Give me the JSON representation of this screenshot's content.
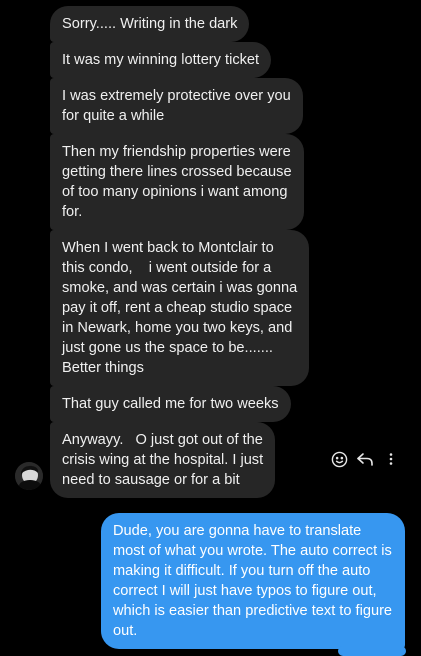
{
  "incoming_messages": [
    {
      "text": "Sorry..... Writing in the dark"
    },
    {
      "text": "It was my winning lottery ticket"
    },
    {
      "text": "I was extremely protective over you\nfor quite a while"
    },
    {
      "text": "Then my friendship properties were\ngetting there lines crossed because\nof too many opinions i want among\nfor."
    },
    {
      "text": "When I went back to Montclair to\nthis condo,    i went outside for a\nsmoke, and was certain i was gonna\npay it off, rent a cheap studio space\nin Newark, home you two keys, and\njust gone us the space to be.......\nBetter things"
    },
    {
      "text": "That guy called me for two weeks"
    },
    {
      "text": "Anywayy.   O just got out of the\ncrisis wing at the hospital. I just\nneed to sausage or for a bit"
    }
  ],
  "outgoing_messages": [
    {
      "text": "Dude, you are gonna have to translate most of what you wrote. The auto correct is making it difficult. If you turn off the auto correct I will just have typos to figure out, which is easier than predictive text to figure out."
    }
  ],
  "message_actions": [
    {
      "icon": "emoji-react-icon"
    },
    {
      "icon": "reply-icon"
    },
    {
      "icon": "more-options-icon"
    }
  ],
  "colors": {
    "background": "#000000",
    "incoming_bubble": "#262626",
    "outgoing_bubble": "#3797f0",
    "text": "#f0f0f0"
  }
}
